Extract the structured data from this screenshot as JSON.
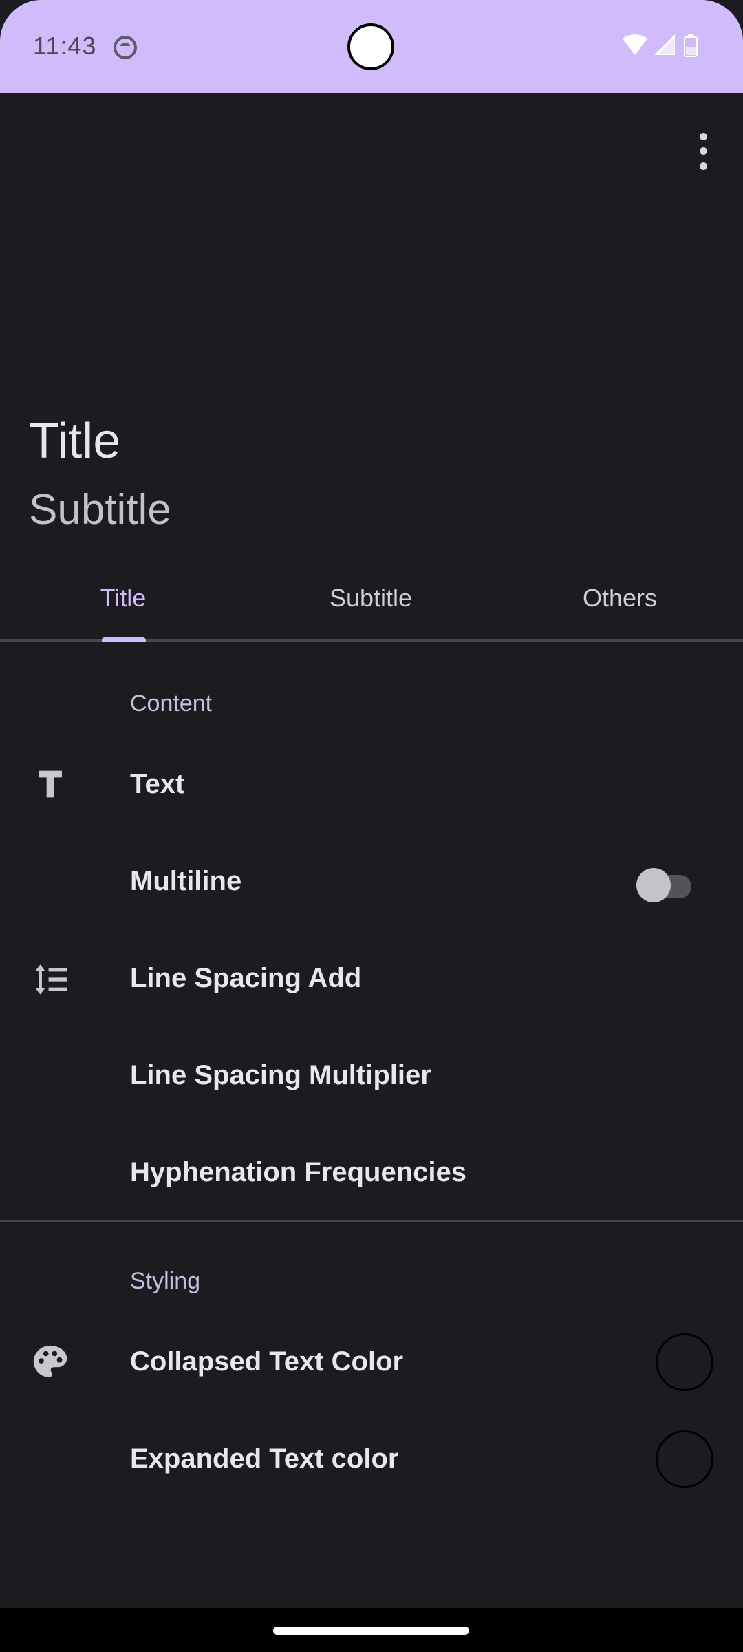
{
  "status_bar": {
    "time": "11:43",
    "icons": [
      "notification-icon",
      "wifi-icon",
      "signal-icon",
      "battery-icon"
    ]
  },
  "header": {
    "title": "Title",
    "subtitle": "Subtitle",
    "menu_icon": "overflow-menu-icon"
  },
  "tabs": [
    {
      "label": "Title",
      "selected": true
    },
    {
      "label": "Subtitle",
      "selected": false
    },
    {
      "label": "Others",
      "selected": false
    }
  ],
  "sections": {
    "content": {
      "header": "Content",
      "items": [
        {
          "label": "Text",
          "icon": "text-format-icon"
        },
        {
          "label": "Multiline",
          "toggle": false
        },
        {
          "label": "Line Spacing Add",
          "icon": "line-spacing-icon"
        },
        {
          "label": "Line Spacing Multiplier"
        },
        {
          "label": "Hyphenation Frequencies"
        }
      ]
    },
    "styling": {
      "header": "Styling",
      "items": [
        {
          "label": "Collapsed Text Color",
          "icon": "palette-icon",
          "swatch": "#1c1b20"
        },
        {
          "label": "Expanded Text color",
          "swatch": "#1c1b20"
        }
      ]
    }
  },
  "colors": {
    "accent": "#d0bcfb",
    "background": "#1c1b20",
    "status_bar": "#d0bcfb"
  }
}
